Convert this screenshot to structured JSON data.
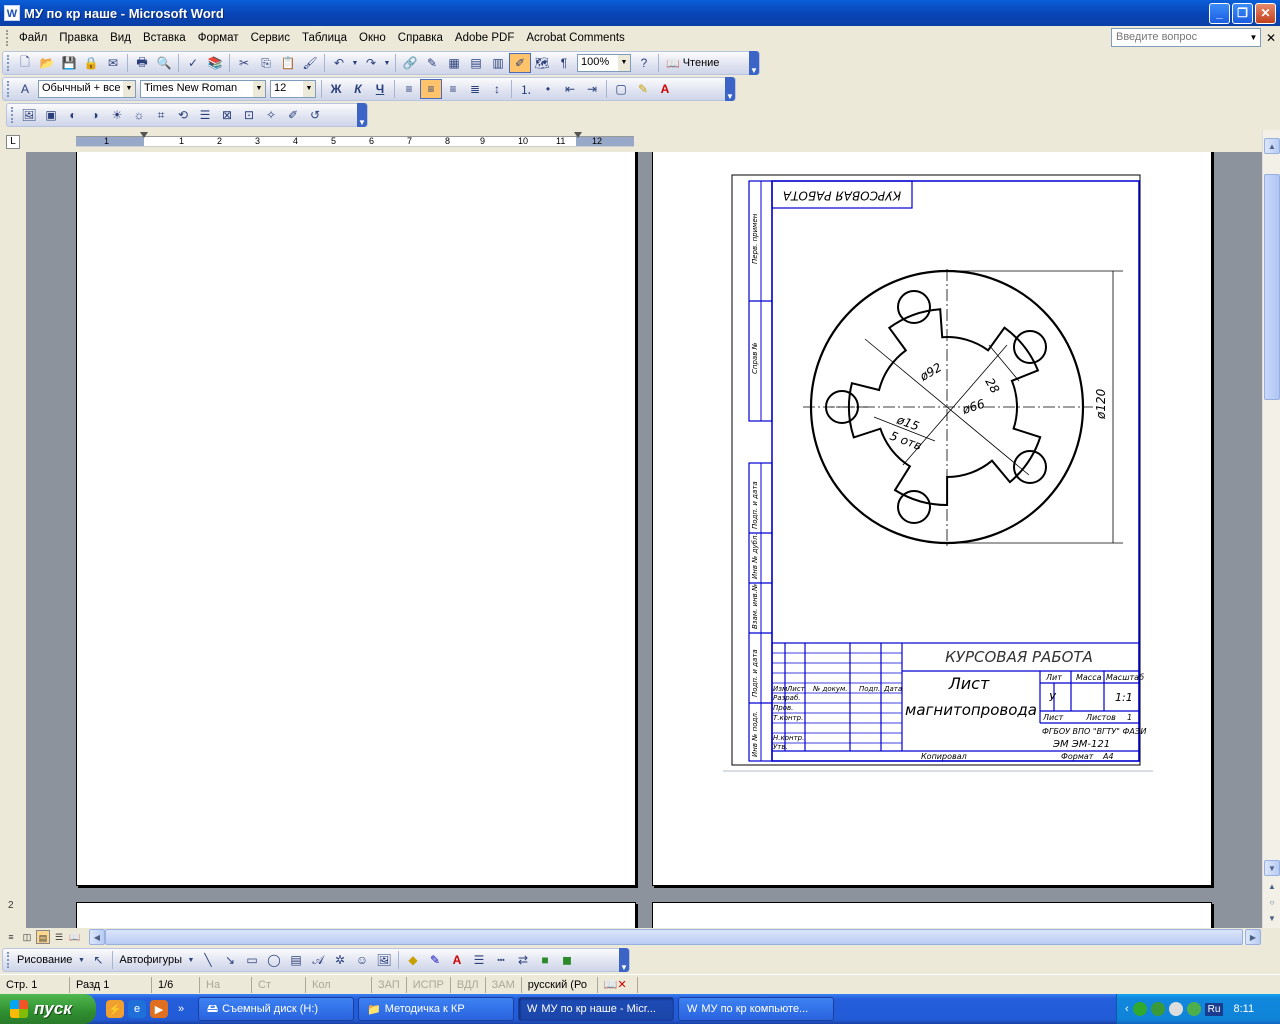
{
  "window": {
    "title": "МУ по кр наше - Microsoft Word",
    "app_icon": "W"
  },
  "menu": [
    "Файл",
    "Правка",
    "Вид",
    "Вставка",
    "Формат",
    "Сервис",
    "Таблица",
    "Окно",
    "Справка",
    "Adobe PDF",
    "Acrobat Comments"
  ],
  "help_placeholder": "Введите вопрос",
  "standard_toolbar": {
    "zoom": "100%",
    "read_label": "Чтение"
  },
  "format_toolbar": {
    "style": "Обычный + все",
    "font": "Times New Roman",
    "size": "12",
    "bold": "Ж",
    "italic": "К",
    "underline": "Ч"
  },
  "ruler": {
    "labels": [
      "1",
      "2",
      "1",
      "2",
      "3",
      "4",
      "5",
      "6",
      "7",
      "8",
      "9",
      "10",
      "11",
      "12"
    ]
  },
  "drawing": {
    "header_mirrored": "КУРСОВАЯ РАБОТА",
    "side_labels": [
      "Перв. примен",
      "Справ №",
      "Подп. и дата",
      "Инв № дубл.",
      "Взам. инв.№",
      "Подп. и дата",
      "Инв № подл."
    ],
    "dims": {
      "d92": "ø92",
      "d28": "28",
      "d66": "ø66",
      "d15": "ø15",
      "holes": "5 отв",
      "d120": "ø120"
    },
    "stamp": {
      "title": "КУРСОВАЯ РАБОТА",
      "part_name_1": "Лист",
      "part_name_2": "магнитопровода",
      "col_heads": [
        "Изм",
        "Лист",
        "№ докум.",
        "Подп.",
        "Дата"
      ],
      "rows": [
        "Разраб.",
        "Пров.",
        "Т.контр.",
        "Н.контр.",
        "Утв."
      ],
      "lit": "Лит",
      "mass": "Масса",
      "scale": "Масштаб",
      "lit_value": "У",
      "scale_value": "1:1",
      "sheet": "Лист",
      "sheets": "Листов",
      "sheets_value": "1",
      "org_1": "ФГБОУ ВПО \"ВГТУ\"  ФАЭИ",
      "org_2": "ЭМ      ЭМ-121",
      "copied": "Копировал",
      "format": "Формат",
      "format_value": "А4"
    }
  },
  "status": {
    "page": "Стр. 1",
    "section": "Разд 1",
    "pages": "1/6",
    "at": "На",
    "ln": "Ст",
    "col": "Кол",
    "rec": "ЗАП",
    "trk": "ИСПР",
    "ext": "ВДЛ",
    "ovr": "ЗАМ",
    "lang": "русский (Ро"
  },
  "drawing_toolbar": {
    "draw": "Рисование",
    "autoshapes": "Автофигуры"
  },
  "taskbar": {
    "start": "пуск",
    "tasks": [
      "Съемный диск (H:)",
      "Методичка к КР",
      "МУ по кр наше - Micr...",
      "МУ по кр компьюте..."
    ],
    "lang": "Ru",
    "time": "8:11"
  },
  "page_nav_marker": "2"
}
